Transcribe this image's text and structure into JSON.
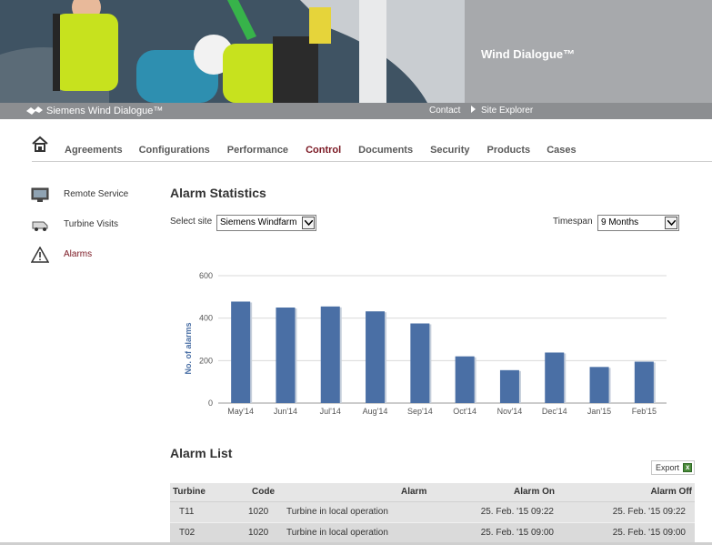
{
  "hero": {
    "title": "Wind Dialogue™"
  },
  "topbar": {
    "brand": "Siemens Wind Dialogue™",
    "links": [
      "Contact",
      "Site Explorer"
    ]
  },
  "nav": {
    "items": [
      "Agreements",
      "Configurations",
      "Performance",
      "Control",
      "Documents",
      "Security",
      "Products",
      "Cases"
    ],
    "active": "Control"
  },
  "sidenav": {
    "items": [
      {
        "label": "Remote Service",
        "icon": "monitor-icon"
      },
      {
        "label": "Turbine Visits",
        "icon": "van-icon"
      },
      {
        "label": "Alarms",
        "icon": "warning-icon"
      }
    ],
    "active": "Alarms"
  },
  "stats": {
    "heading": "Alarm Statistics",
    "site_label": "Select site",
    "site_value": "Siemens Windfarm",
    "timespan_label": "Timespan",
    "timespan_value": "9 Months"
  },
  "chart_data": {
    "type": "bar",
    "categories": [
      "May'14",
      "Jun'14",
      "Jul'14",
      "Aug'14",
      "Sep'14",
      "Oct'14",
      "Nov'14",
      "Dec'14",
      "Jan'15",
      "Feb'15"
    ],
    "values": [
      478,
      450,
      455,
      432,
      375,
      220,
      155,
      238,
      170,
      195
    ],
    "title": "",
    "xlabel": "",
    "ylabel": "No. of alarms",
    "ylim": [
      0,
      600
    ],
    "yticks": [
      0,
      200,
      400,
      600
    ],
    "grid": true,
    "bar_color": "#4a6fa5"
  },
  "alarm_list": {
    "heading": "Alarm List",
    "export_label": "Export",
    "columns": [
      "Turbine",
      "Code",
      "Alarm",
      "Alarm On",
      "Alarm Off"
    ],
    "rows": [
      {
        "turbine": "T11",
        "code": "1020",
        "alarm": "Turbine in local operation",
        "on": "25. Feb. '15 09:22",
        "off": "25. Feb. '15 09:22"
      },
      {
        "turbine": "T02",
        "code": "1020",
        "alarm": "Turbine in local operation",
        "on": "25. Feb. '15 09:00",
        "off": "25. Feb. '15 09:00"
      }
    ]
  },
  "colors": {
    "accent": "#7a1722",
    "topbar": "#8c8e91",
    "brand_panel": "#a7a9ac"
  }
}
